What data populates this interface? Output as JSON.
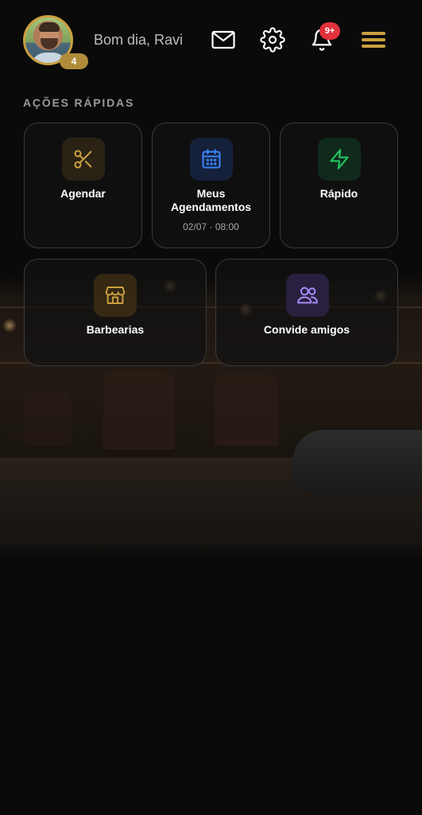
{
  "header": {
    "greeting": "Bom dia, Ravi",
    "level": "4",
    "notifications_count": "9+",
    "icons": [
      "mail-icon",
      "gear-icon",
      "bell-icon",
      "menu-icon"
    ]
  },
  "quick_actions": {
    "title": "AÇÕES RÁPIDAS",
    "items": [
      {
        "label": "Agendar",
        "icon": "scissors-icon",
        "color": "#c9a040"
      },
      {
        "label": "Meus Agendamentos",
        "sub": "02/07 · 08:00",
        "icon": "calendar-icon",
        "color": "#3b82f6"
      },
      {
        "label": "Rápido",
        "icon": "lightning-icon",
        "color": "#22c55e"
      },
      {
        "label": "Barbearias",
        "icon": "store-icon",
        "color": "#c9a040"
      },
      {
        "label": "Convide amigos",
        "icon": "users-icon",
        "color": "#a78bfa"
      }
    ]
  },
  "colors": {
    "accent": "#c9a040",
    "background": "#0a0a0a",
    "badge": "#e0313d"
  }
}
